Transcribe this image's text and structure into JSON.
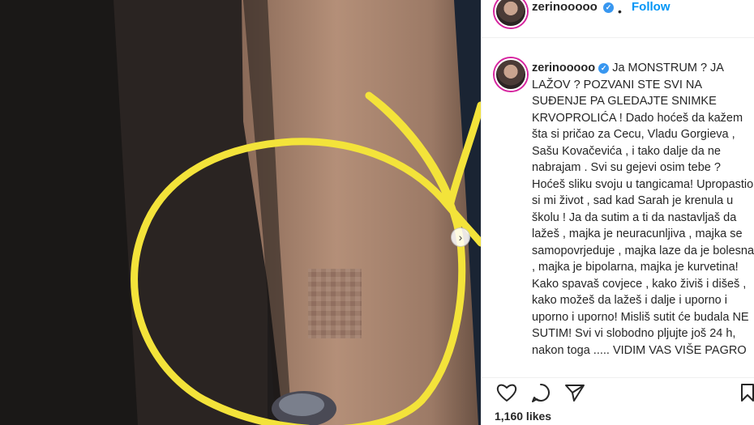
{
  "post": {
    "username": "zerinooooo",
    "follow_label": "Follow",
    "dot": "•",
    "verified_mark": "✓",
    "caption_user": "zerinooooo",
    "caption_text": "Ja MONSTRUM ? JA LAŽOV ? POZVANI STE SVI NA SUĐENJE PA GLEDAJTE SNIMKE KRVOPROLIĆA ! Dado hoćeš da kažem šta si pričao za Cecu, Vladu Gorgieva , Sašu Kovačevića , i tako dalje da ne nabrajam . Svi su gejevi osim tebe ? Hoćeš sliku svoju u tangicama! Upropastio si mi život , sad kad Sarah je krenula u školu ! Ja da sutim a ti da nastavljaš da lažeš , majka je neuracunljiva , majka se samopovrjeduje , majka laze da je bolesna , majka je bipolarna, majka je kurvetina! Kako spavaš covjece , kako živiš i dišeš , kako možeš da lažeš i dalje i uporno i uporno i uporno! Misliš sutit će budala NE SUTIM! Svi vi slobodno pljujte još 24 h, nakon toga ..... VIDIM VAS VIŠE PAGRO",
    "likes": "1,160 likes",
    "next_arrow": "›"
  },
  "icons": {
    "like": "heart-icon",
    "comment": "comment-icon",
    "share": "paper-plane-icon",
    "save": "bookmark-icon",
    "next": "chevron-right-icon",
    "verified": "verified-badge-icon"
  },
  "colors": {
    "follow": "#0095f6",
    "verified": "#3897f0",
    "annotation": "#f3e33a",
    "text": "#262626"
  }
}
